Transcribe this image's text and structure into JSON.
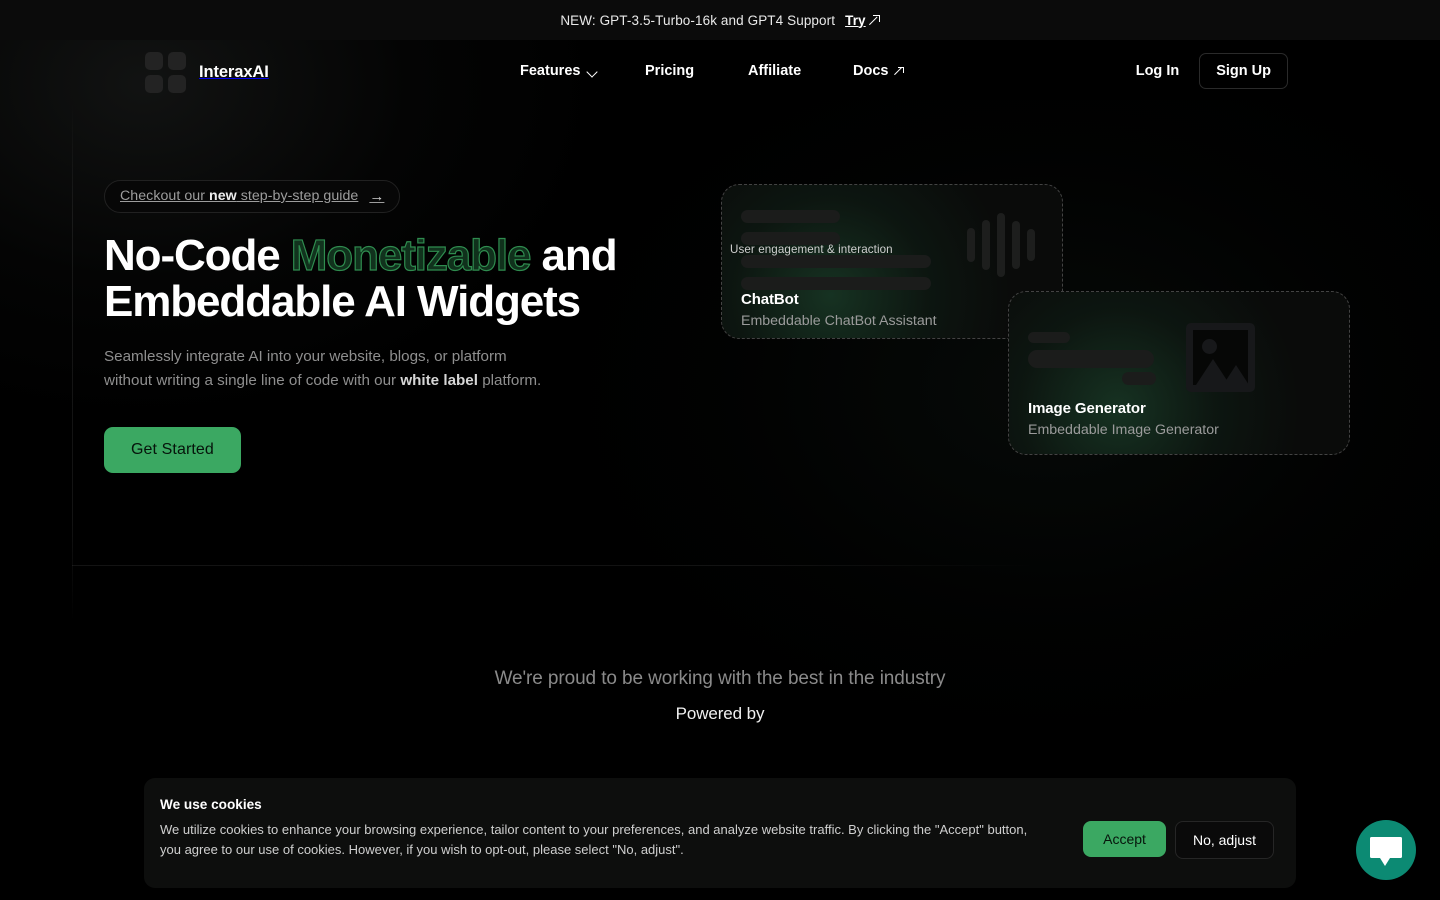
{
  "announcement": {
    "text": "NEW: GPT-3.5-Turbo-16k and GPT4 Support",
    "cta_label": "Try",
    "cta_icon": "external-link-icon"
  },
  "header": {
    "brand_name": "InteraxAI",
    "logo_icon": "four-squares-logo-icon",
    "nav": [
      {
        "label": "Features",
        "icon": "chevron-down-icon"
      },
      {
        "label": "Pricing",
        "icon": ""
      },
      {
        "label": "Affiliate",
        "icon": ""
      },
      {
        "label": "Docs",
        "icon": "external-link-icon"
      }
    ],
    "login_label": "Log In",
    "signup_label": "Sign Up"
  },
  "hero": {
    "pill": {
      "prefix": "Checkout our ",
      "strong": "new",
      "suffix": " step-by-step guide",
      "arrow": "→"
    },
    "title_part1": "No-Code ",
    "title_highlight": "Monetizable",
    "title_part2": " and Embeddable AI Widgets",
    "subtitle_part1": "Seamlessly integrate AI into your website, blogs, or platform without writing a single line of code with our ",
    "subtitle_strong": "white label",
    "subtitle_part2": " platform.",
    "cta_label": "Get Started"
  },
  "widgets": [
    {
      "name": "ChatBot",
      "description": "Embeddable ChatBot Assistant",
      "overlay_caption": "User engagement & interaction",
      "icon": "audio-waveform-icon"
    },
    {
      "name": "Image Generator",
      "description": "Embeddable Image Generator",
      "overlay_caption": "",
      "icon": "image-picture-icon"
    }
  ],
  "partners": {
    "title": "We're proud to be working with the best in the industry",
    "powered_by": "Powered by"
  },
  "cookies": {
    "heading": "We use cookies",
    "body": "We utilize cookies to enhance your browsing experience, tailor content to your preferences, and analyze website traffic. By clicking the \"Accept\" button, you agree to our use of cookies. However, if you wish to opt-out, please select \"No, adjust\".",
    "accept_label": "Accept",
    "adjust_label": "No, adjust"
  },
  "chat_fab": {
    "icon": "chat-bubble-icon"
  },
  "colors": {
    "background": "#000000",
    "accent_green": "#3ba862",
    "outline_green": "#2f8c4f",
    "fab_teal": "#0c8a73",
    "muted_text": "#8f8f8f"
  }
}
